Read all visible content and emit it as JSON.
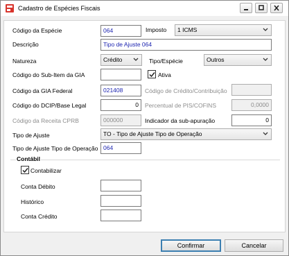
{
  "window": {
    "title": "Cadastro de Espécies Fiscais"
  },
  "form": {
    "codigo_especie": {
      "label": "Código da Espécie",
      "value": "064"
    },
    "imposto": {
      "label": "Imposto",
      "value": "1 ICMS"
    },
    "descricao": {
      "label": "Descrição",
      "value": "Tipo de Ajuste 064"
    },
    "natureza": {
      "label": "Natureza",
      "value": "Crédito"
    },
    "tipo_especie": {
      "label": "Tipo/Espécie",
      "value": "Outros"
    },
    "sub_item_gia": {
      "label": "Código do Sub-Item da GIA",
      "value": ""
    },
    "ativa": {
      "label": "Ativa",
      "checked": true
    },
    "gia_federal": {
      "label": "Código da GIA Federal",
      "value": "021408"
    },
    "credito_contribuicao": {
      "label": "Código de Crédito/Contribuição",
      "value": ""
    },
    "dcip": {
      "label": "Código do DCIP/Base Legal",
      "value": "0"
    },
    "percentual_pis": {
      "label": "Percentual de PIS/COFINS",
      "value": "0,0000"
    },
    "receita_cprb": {
      "label": "Código da Receita CPRB",
      "value": "000000"
    },
    "indicador_subapuracao": {
      "label": "Indicador da sub-apuração",
      "value": "0"
    },
    "tipo_ajuste": {
      "label": "Tipo de Ajuste",
      "value": "TO - Tipo de Ajuste Tipo de Operação"
    },
    "tipo_ajuste_operacao": {
      "label": "Tipo de Ajuste Tipo de Operação",
      "value": "064"
    }
  },
  "contabil": {
    "title": "Contábil",
    "contabilizar": {
      "label": "Contabilizar",
      "checked": true
    },
    "conta_debito": {
      "label": "Conta Débito",
      "value": ""
    },
    "historico": {
      "label": "Histórico",
      "value": ""
    },
    "conta_credito": {
      "label": "Conta Crédito",
      "value": ""
    }
  },
  "buttons": {
    "confirm": "Confirmar",
    "cancel": "Cancelar"
  },
  "colors": {
    "value_text": "#1c24b0",
    "default_border": "#3c7fb1"
  }
}
